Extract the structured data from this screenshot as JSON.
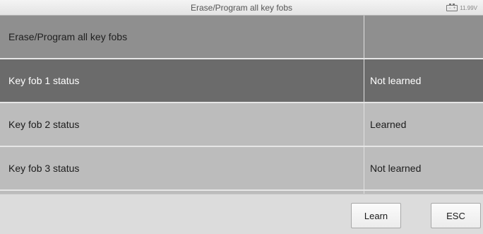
{
  "title_bar": {
    "title": "Erase/Program all key fobs",
    "battery_voltage": "11.99V",
    "battery_icon": "battery-icon"
  },
  "table": {
    "header": {
      "label": "Erase/Program all key fobs",
      "value": ""
    },
    "rows": [
      {
        "label": "Key fob 1 status",
        "value": "Not learned",
        "selected": true
      },
      {
        "label": "Key fob 2 status",
        "value": "Learned",
        "selected": false
      },
      {
        "label": "Key fob 3 status",
        "value": "Not learned",
        "selected": false
      }
    ]
  },
  "buttons": {
    "learn": "Learn",
    "esc": "ESC"
  },
  "colors": {
    "header_row": "#8f8f8f",
    "selected_row": "#6b6b6b",
    "normal_row": "#bcbcbc"
  }
}
